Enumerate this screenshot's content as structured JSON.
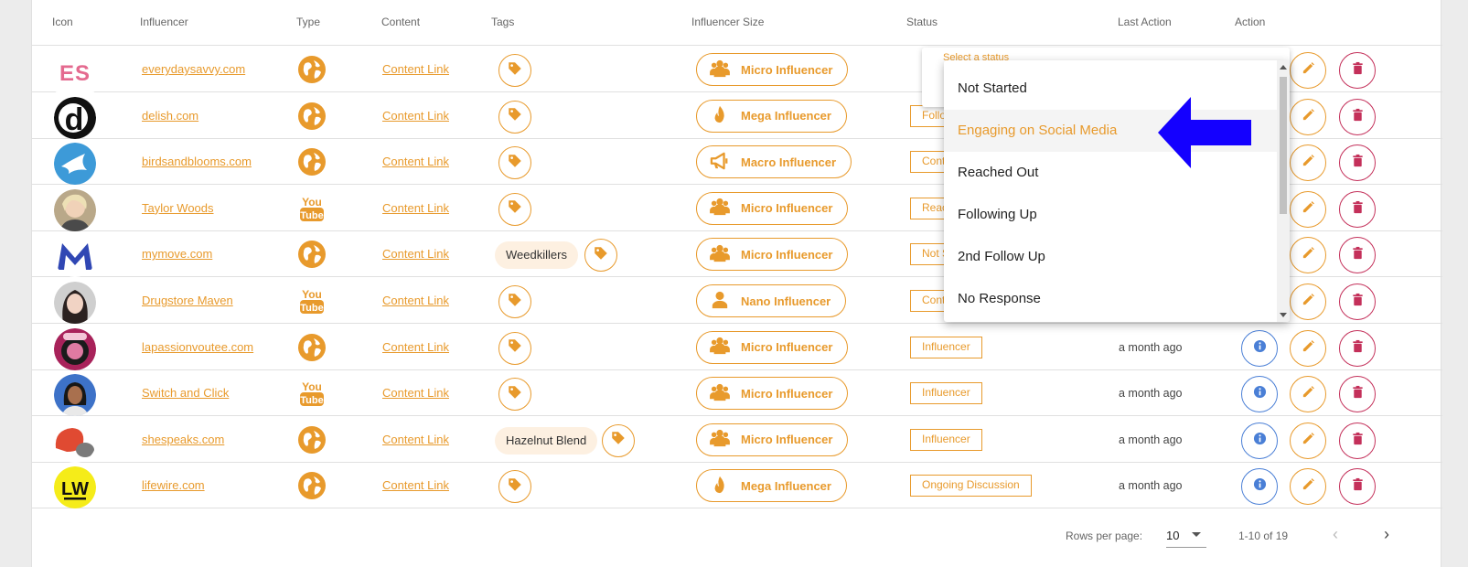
{
  "headers": {
    "icon": "Icon",
    "influencer": "Influencer",
    "type": "Type",
    "content": "Content",
    "tags": "Tags",
    "size": "Influencer Size",
    "status": "Status",
    "last_action": "Last Action",
    "action": "Action"
  },
  "rows": [
    {
      "name": "everydaysavvy.com",
      "type": "web",
      "content": "Content Link",
      "tag": "",
      "size": "Micro Influencer",
      "size_icon": "group",
      "status": "",
      "last_action": ""
    },
    {
      "name": "delish.com",
      "type": "web",
      "content": "Content Link",
      "tag": "",
      "size": "Mega Influencer",
      "size_icon": "fire",
      "status": "Follo",
      "last_action": ""
    },
    {
      "name": "birdsandblooms.com",
      "type": "web",
      "content": "Content Link",
      "tag": "",
      "size": "Macro Influencer",
      "size_icon": "megaphone",
      "status": "Cont",
      "last_action": ""
    },
    {
      "name": "Taylor Woods",
      "type": "youtube",
      "content": "Content Link",
      "tag": "",
      "size": "Micro Influencer",
      "size_icon": "group",
      "status": "Reac",
      "last_action": ""
    },
    {
      "name": "mymove.com",
      "type": "web",
      "content": "Content Link",
      "tag": "Weedkillers",
      "size": "Micro Influencer",
      "size_icon": "group",
      "status": "Not S",
      "last_action": ""
    },
    {
      "name": "Drugstore Maven",
      "type": "youtube",
      "content": "Content Link",
      "tag": "",
      "size": "Nano Influencer",
      "size_icon": "person",
      "status": "Cont",
      "last_action": ""
    },
    {
      "name": "lapassionvoutee.com",
      "type": "web",
      "content": "Content Link",
      "tag": "",
      "size": "Micro Influencer",
      "size_icon": "group",
      "status": "Influencer",
      "last_action": "a month ago"
    },
    {
      "name": "Switch and Click",
      "type": "youtube",
      "content": "Content Link",
      "tag": "",
      "size": "Micro Influencer",
      "size_icon": "group",
      "status": "Influencer",
      "last_action": "a month ago"
    },
    {
      "name": "shespeaks.com",
      "type": "web",
      "content": "Content Link",
      "tag": "Hazelnut Blend",
      "size": "Micro Influencer",
      "size_icon": "group",
      "status": "Influencer",
      "last_action": "a month ago"
    },
    {
      "name": "lifewire.com",
      "type": "web",
      "content": "Content Link",
      "tag": "",
      "size": "Mega Influencer",
      "size_icon": "fire",
      "status": "Ongoing Discussion",
      "last_action": "a month ago"
    }
  ],
  "logos": {
    "es": "ES",
    "d": "d",
    "lw": "LW"
  },
  "youtube": {
    "top": "You",
    "bottom": "Tube"
  },
  "status_select": {
    "label": "Select a status"
  },
  "dropdown": {
    "options": [
      "Not Started",
      "Engaging on Social Media",
      "Reached Out",
      "Following Up",
      "2nd Follow Up",
      "No Response"
    ],
    "highlighted_index": 1
  },
  "footer": {
    "rows_per_page_label": "Rows per page:",
    "rows_per_page": "10",
    "range": "1-10 of 19"
  },
  "colors": {
    "accent": "#e89a2c",
    "info": "#4a7fd6",
    "delete": "#c4305a",
    "arrow": "#1400ff"
  }
}
